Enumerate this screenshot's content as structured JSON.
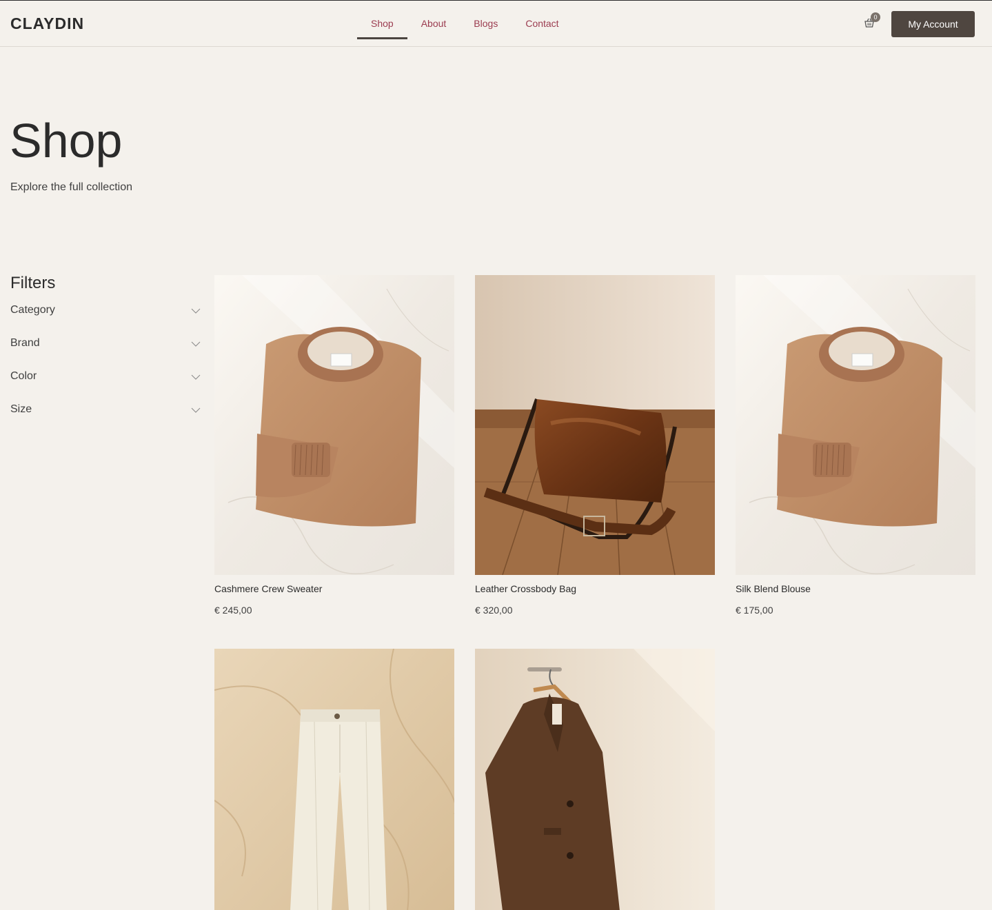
{
  "brand": {
    "name": "CLAYDIN"
  },
  "nav": {
    "items": [
      {
        "label": "Shop",
        "active": true
      },
      {
        "label": "About",
        "active": false
      },
      {
        "label": "Blogs",
        "active": false
      },
      {
        "label": "Contact",
        "active": false
      }
    ]
  },
  "cart": {
    "count": "0",
    "icon": "basket-icon"
  },
  "account": {
    "label": "My Account"
  },
  "hero": {
    "title": "Shop",
    "subtitle": "Explore the full collection"
  },
  "filters": {
    "title": "Filters",
    "items": [
      {
        "label": "Category"
      },
      {
        "label": "Brand"
      },
      {
        "label": "Color"
      },
      {
        "label": "Size"
      }
    ]
  },
  "products": [
    {
      "name": "Cashmere Crew Sweater",
      "price": "€ 245,00",
      "image": "camel-sweater"
    },
    {
      "name": "Leather Crossbody Bag",
      "price": "€ 320,00",
      "image": "brown-leather-bag"
    },
    {
      "name": "Silk Blend Blouse",
      "price": "€ 175,00",
      "image": "camel-sweater"
    },
    {
      "name": "",
      "price": "",
      "image": "cream-trousers"
    },
    {
      "name": "",
      "price": "",
      "image": "brown-wool-coat"
    }
  ],
  "colors": {
    "background": "#f4f1ec",
    "nav_link": "#9b3b4f",
    "button": "#4f4640",
    "text": "#2b2b2b"
  }
}
